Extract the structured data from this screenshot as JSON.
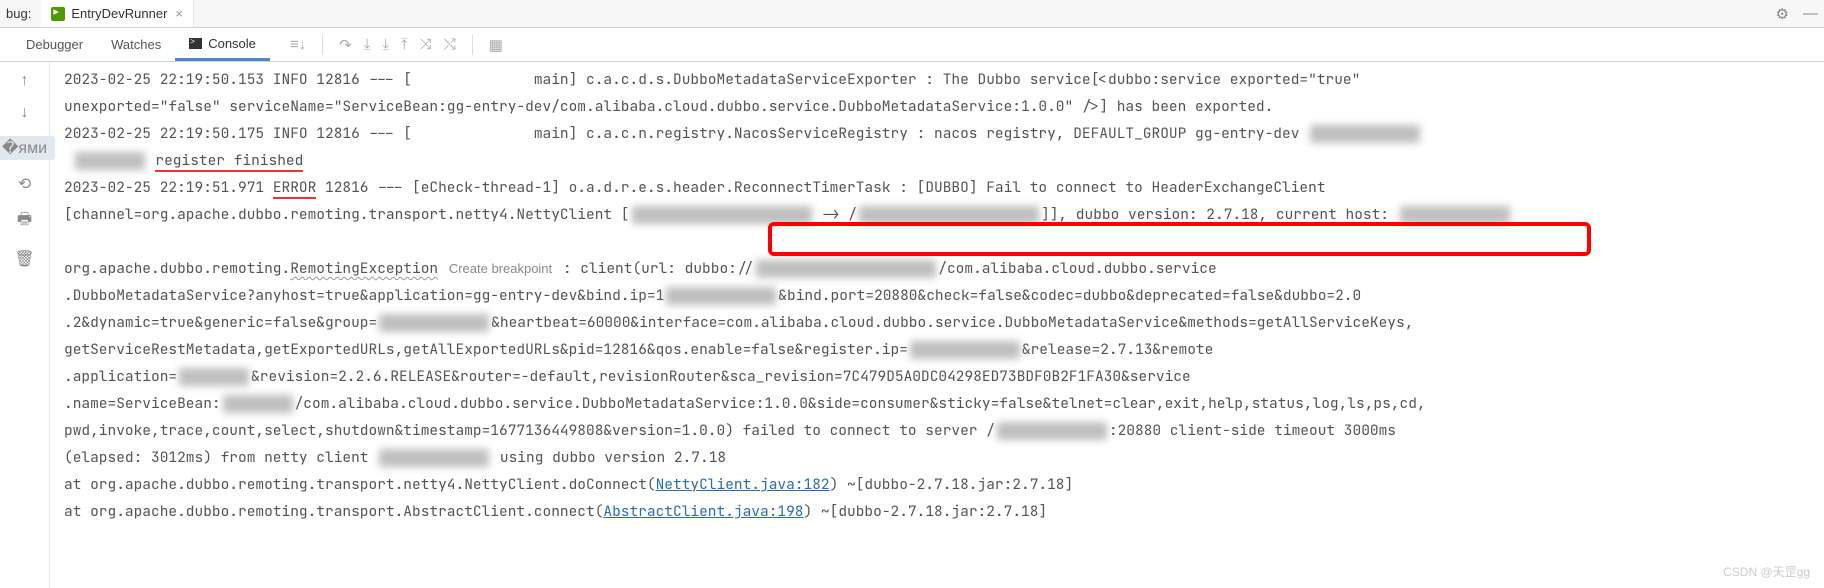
{
  "topbar": {
    "bug_label": "bug:",
    "run_config": "EntryDevRunner",
    "close": "×",
    "settings_title": "Settings",
    "minimize_title": "Minimize"
  },
  "tabs": {
    "debugger": "Debugger",
    "watches": "Watches",
    "console": "Console"
  },
  "toolbar": {
    "softwrap_title": "Soft-wrap",
    "scrolltoend_title": "Scroll to End",
    "print_title": "Print",
    "clear_title": "Clear"
  },
  "gutter": {
    "up_title": "Up Stack",
    "down_title": "Down Stack",
    "wrap_title": "Toggle Wrap",
    "rerun_title": "Rerun",
    "print_title": "Print",
    "trash_title": "Clear"
  },
  "log": {
    "l1a": "2023-02-25 22:19:50.153  INFO 12816 --- [",
    "l1b": "main] c.a.c.d.s.DubboMetadataServiceExporter   : The Dubbo service[<dubbo:service exported=\"true\"",
    "l2": " unexported=\"false\" serviceName=\"ServiceBean:gg-entry-dev/com.alibaba.cloud.dubbo.service.DubboMetadataService:1.0.0\" />] has been exported.",
    "l3a": "2023-02-25 22:19:50.175  INFO 12816 --- [",
    "l3b": "main] c.a.c.n.registry.NacosServiceRegistry    : nacos registry, DEFAULT_GROUP gg-entry-dev",
    "l4": "register finished",
    "l5a": "2023-02-25 22:19:51.971",
    "l5err": "ERROR",
    "l5b": " 12816 --- [eCheck-thread-1] o.a.d.r.e.s.",
    "l5c": "header.ReconnectTimerTask",
    "l5d": "    :  [DUBBO] Fail to connect to HeaderExchangeClient",
    "l6a": " [channel=org.apache.dubbo.remoting.transport.netty4.NettyClient [",
    "l6b": " -> /",
    "l6c": "]], dubbo version: 2.7.18, current host:",
    "l7a": "org.apache.dubbo.remoting.",
    "l7ex": "RemotingException",
    "l7hint": "Create breakpoint",
    "l7b": ": client(url: dubbo://",
    "l7c": "/com.alibaba.cloud.dubbo.service",
    "l8a": ".DubboMetadataService?anyhost=true&application=gg-entry-dev&bind.ip=1",
    "l8b": "&bind.port=20880&check=false&codec=dubbo&deprecated=false&dubbo=2.0",
    "l9a": ".2&dynamic=true&generic=false&group=",
    "l9b": "&heartbeat=60000&interface=com.alibaba.cloud.dubbo.service.DubboMetadataService&methods=getAllServiceKeys,",
    "l10a": "getServiceRestMetadata,getExportedURLs,getAllExportedURLs&pid=12816&qos.enable=false&register.ip=",
    "l10b": "&release=2.7.13&remote",
    "l11a": ".application=",
    "l11b": "&revision=2.2.6.RELEASE&router=-default,revisionRouter&sca_revision=7C479D5A0DC04298ED73BDF0B2F1FA30&service",
    "l12a": ".name=ServiceBean:",
    "l12b": "/com.alibaba.cloud.dubbo.service.DubboMetadataService:1.0.0&side=consumer&sticky=false&telnet=clear,exit,help,status,log,ls,ps,cd,",
    "l13a": "pwd,invoke,trace,count,select,shutdown&timestamp=1677136449808&version=1.0.0) failed to connect to server /",
    "l13b": ":20880 client-side timeout 3000ms",
    "l14": "(elapsed: 3012ms) from netty client",
    "l14b": "using dubbo version 2.7.18",
    "l15a": "    at org.apache.dubbo.remoting.transport.netty4.NettyClient.doConnect(",
    "l15lnk": "NettyClient.java:182",
    "l15b": ") ~[dubbo-2.7.18.jar:2.7.18]",
    "l16a": "    at org.apache.dubbo.remoting.transport.AbstractClient.connect(",
    "l16lnk": "AbstractClient.java:198",
    "l16b": ") ~[dubbo-2.7.18.jar:2.7.18]"
  },
  "watermark": "CSDN @天罡gg"
}
